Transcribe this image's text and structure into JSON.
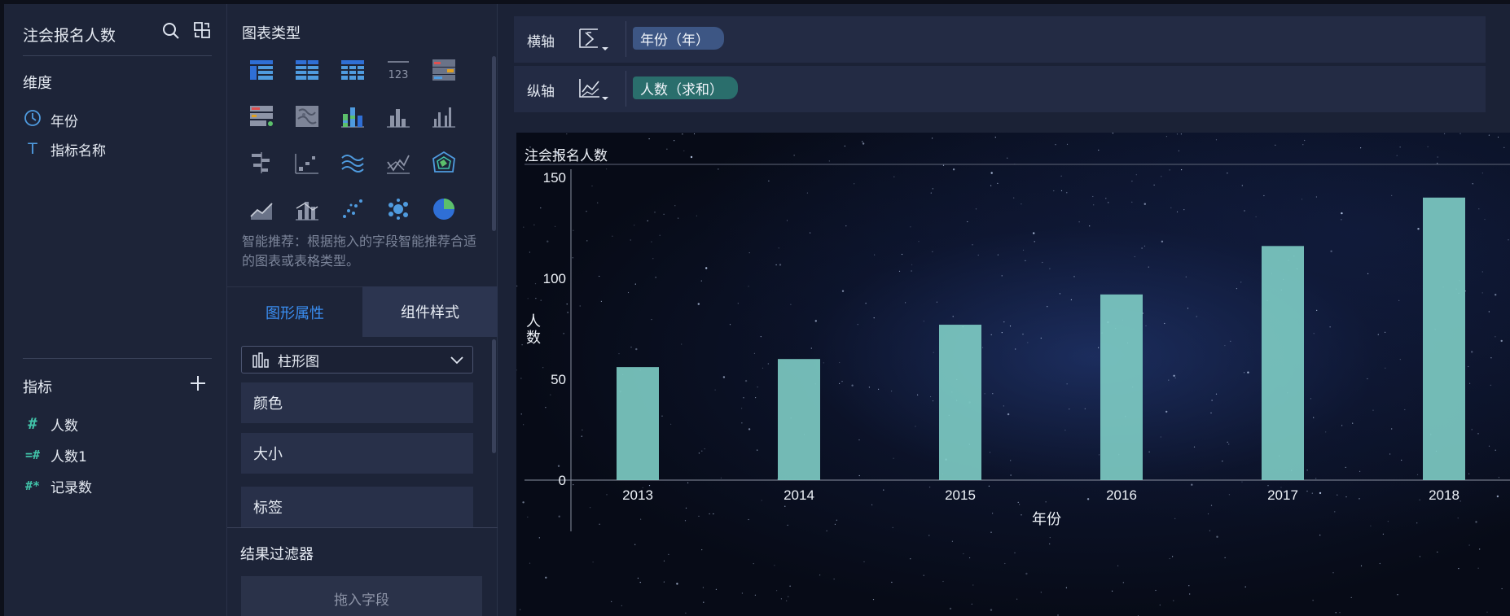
{
  "left_panel": {
    "dataset_title": "注会报名人数",
    "search_icon": "search-icon",
    "switch_icon": "switch-dataset-icon",
    "dimensions_title": "维度",
    "dimensions": [
      {
        "icon": "clock-icon",
        "label": "年份"
      },
      {
        "icon": "text-type-icon",
        "glyph": "T",
        "label": "指标名称"
      }
    ],
    "metrics_title": "指标",
    "metrics": [
      {
        "glyph": "#",
        "label": "人数"
      },
      {
        "glyph": "=#",
        "label": "人数1"
      },
      {
        "glyph": "#*",
        "label": "记录数"
      }
    ]
  },
  "mid_panel": {
    "chart_types_title": "图表类型",
    "chart_types": [
      "table-icon",
      "crosstab-icon",
      "detail-table-icon",
      "kpi-number-icon",
      "kpi-card-icon",
      "indicator-card-icon",
      "area-map-icon",
      "stacked-bar-icon",
      "bar-chart-icon",
      "grouped-bar-icon",
      "horizontal-bar-icon",
      "scatter-step-icon",
      "wave-line-icon",
      "line-compare-icon",
      "radar-icon",
      "area-line-icon",
      "combo-bar-line-icon",
      "scatter-icon",
      "bubble-icon",
      "pie-icon"
    ],
    "kpi_text": "123",
    "smart_tip": "智能推荐：根据拖入的字段智能推荐合适的图表或表格类型。",
    "tabs": [
      {
        "label": "图形属性",
        "active": true
      },
      {
        "label": "组件样式",
        "active": false
      }
    ],
    "chart_type_select": "柱形图",
    "properties": [
      "颜色",
      "大小",
      "标签"
    ],
    "filter_title": "结果过滤器",
    "filter_placeholder": "拖入字段"
  },
  "axes": {
    "x": {
      "label": "横轴",
      "field": "年份（年）"
    },
    "y": {
      "label": "纵轴",
      "field": "人数（求和）"
    }
  },
  "colors": {
    "bar": "#7ecdc5",
    "accent": "#3a8ef2",
    "dim_pill": "#3d5684",
    "meas_pill": "#2a6e6c"
  },
  "chart_data": {
    "type": "bar",
    "title": "注会报名人数",
    "xlabel": "年份",
    "ylabel": "人数",
    "categories": [
      "2013",
      "2014",
      "2015",
      "2016",
      "2017",
      "2018"
    ],
    "values": [
      56,
      60,
      77,
      92,
      116,
      140
    ],
    "ylim": [
      0,
      150
    ],
    "yticks": [
      0,
      50,
      100,
      150
    ],
    "grid": false
  }
}
